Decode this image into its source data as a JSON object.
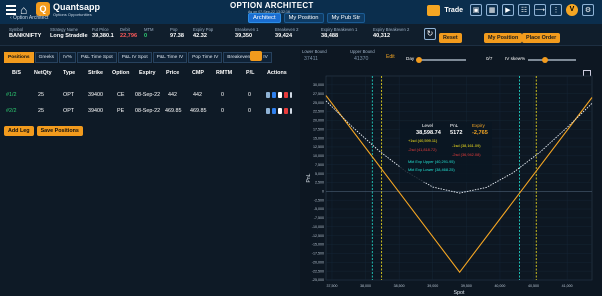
{
  "header": {
    "brand": "Quantsapp",
    "brand_sub": "Options Opportunities",
    "crumb": "‹  Option Architect",
    "title": "OPTION ARCHITECT",
    "subtitle": "As on 07-Sep-22 13:32:16",
    "tabs": [
      "Architect",
      "My Position",
      "My Pub Str"
    ],
    "trade_label": "Trade",
    "avatar_initial": "V"
  },
  "info": {
    "symbol_label": "Symbol",
    "symbol": "BANKNIFTY",
    "strategy_label": "Strategy Name",
    "strategy": "Long Straddle",
    "futprice_label": "Fut Price",
    "futprice": "39,380.1",
    "debit_label": "Debit",
    "debit": "22,796",
    "mtm_label": "MTM",
    "mtm": "0",
    "pop_label": "Pop",
    "pop": "97.38",
    "exppop_label": "Expiry Pop",
    "exppop": "42.32",
    "be1_label": "Breakeven 1",
    "be1": "39,350",
    "be2_label": "Breakeven 2",
    "be2": "39,424",
    "ebe1_label": "Expiry Breakeven 1",
    "ebe1": "38,488",
    "ebe2_label": "Expiry Breakeven 2",
    "ebe2": "40,312",
    "btn_reset": "Reset",
    "btn_myposition": "My Position",
    "btn_placeorder": "Place Order"
  },
  "left": {
    "subtabs": [
      "Positions",
      "Greeks",
      "IV%",
      "P&L Time Spot",
      "P&L IV Spot",
      "P&L Time IV",
      "Pop Time IV",
      "Breakeven Time IV"
    ],
    "columns": [
      "B/S",
      "NetQty",
      "Type",
      "Strike",
      "Option",
      "Expiry",
      "Price",
      "CMP",
      "RMTM",
      "P/L",
      "Actions"
    ],
    "rows": [
      {
        "bs": "#1/2",
        "qty": "25",
        "type": "OPT",
        "strike": "39400",
        "option": "CE",
        "expiry": "08-Sep-22",
        "price": "442",
        "cmp": "442",
        "rmtm": "0",
        "pl": "0"
      },
      {
        "bs": "#2/2",
        "qty": "25",
        "type": "OPT",
        "strike": "39400",
        "option": "PE",
        "expiry": "08-Sep-22",
        "price": "469.85",
        "cmp": "469.85",
        "rmtm": "0",
        "pl": "0"
      }
    ],
    "btn_addleg": "Add Leg",
    "btn_savepos": "Save Positions"
  },
  "right": {
    "lower_label": "Lower Bound",
    "lower_val": "37411",
    "upper_label": "Upper Bound",
    "upper_val": "41370",
    "edit": "Edit",
    "day_label": "Day",
    "day_val": "0/7",
    "iv_label": "IV skew%",
    "colors": {
      "orange": "#f5a623",
      "white": "#e8eef5",
      "sd1": "#f5e21d",
      "sd2": "#e83c3c",
      "mrk": "#23e3d4"
    }
  },
  "chart_data": {
    "type": "line",
    "xlabel": "Spot",
    "ylabel": "PnL",
    "xlim": [
      37411,
      41370
    ],
    "ylim": [
      -25000,
      32500
    ],
    "x_ticks": [
      37500,
      38000,
      38500,
      39000,
      39500,
      40000,
      40500,
      41000
    ],
    "x_tick_labels": [
      "37,500",
      "38,000",
      "38,500",
      "39,000",
      "39,500",
      "40,000",
      "40,500",
      "41,000"
    ],
    "y_ticks": [
      30000,
      27500,
      25000,
      22500,
      20000,
      17500,
      15000,
      12500,
      10000,
      7500,
      5000,
      2500,
      0,
      -2500,
      -5000,
      -7500,
      -10000,
      -12500,
      -15000,
      -17500,
      -20000,
      -22500,
      -25000
    ],
    "y_tick_labels": [
      "30,000",
      "27,500",
      "25,000",
      "22,500",
      "20,000",
      "17,500",
      "15,000",
      "12,500",
      "10,000",
      "7,500",
      "5,000",
      "2,500",
      "0",
      "-2,500",
      "-5,000",
      "-7,500",
      "-10,000",
      "-12,500",
      "-15,000",
      "-17,500",
      "-20,000",
      "-22,500",
      "-25,000"
    ],
    "series": [
      {
        "name": "Expiry",
        "style": "solid",
        "color": "#f5a623",
        "x": [
          37411,
          39400,
          41370
        ],
        "y": [
          26999,
          -22796,
          26444
        ]
      },
      {
        "name": "T+0",
        "style": "dashed",
        "color": "#e8eef5",
        "x": [
          37411,
          37800,
          38200,
          38600,
          39000,
          39400,
          39800,
          40200,
          40600,
          41000,
          41370
        ],
        "y": [
          25500,
          18200,
          11400,
          5600,
          1200,
          -500,
          1100,
          5300,
          11100,
          18000,
          24800
        ]
      }
    ],
    "vlines": [
      {
        "x": 38239,
        "color": "#f5e21d",
        "label": "+1sd"
      },
      {
        "x": 40540,
        "color": "#f5e21d",
        "label": "-1sd"
      },
      {
        "x": 38100,
        "color": "#23e3d4",
        "label": "Mkt Exp Lower"
      },
      {
        "x": 40292,
        "color": "#23e3d4",
        "label": "Mkt Exp Upper"
      }
    ],
    "tooltip": {
      "level_label": "Level",
      "level": "38,598.74",
      "pnl_label": "PnL",
      "pnl": "5172",
      "expiry_label": "Expiry",
      "expiry": "-2,765",
      "items": [
        {
          "label": "+1sd (40,599.11)",
          "color": "#f5e21d"
        },
        {
          "label": "-1sd (38,161.09)",
          "color": "#f5e21d"
        },
        {
          "label": "-2sd (41,818.72)",
          "color": "#e83c3c"
        },
        {
          "label": "-2sd (36,942.08)",
          "color": "#e83c3c"
        },
        {
          "label": "Mkt Exp Upper (40,291.95)",
          "color": "#23e3d4"
        },
        {
          "label": "Mkt Exp Lower (38,468.25)",
          "color": "#23e3d4"
        }
      ]
    }
  }
}
